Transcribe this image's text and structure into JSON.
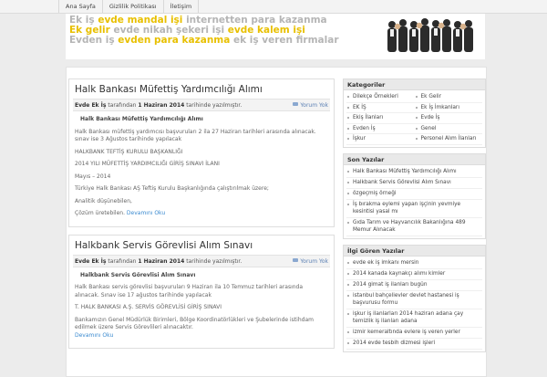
{
  "nav": [
    "Ana Sayfa",
    "Gizlilik Politikası",
    "İletişim"
  ],
  "banner": {
    "line1": [
      {
        "t": "Ek iş",
        "c": "#b5b5b5"
      },
      {
        "t": "evde mandal işi",
        "c": "#e8c000"
      },
      {
        "t": "internetten para kazanma",
        "c": "#b5b5b5"
      }
    ],
    "line2": [
      {
        "t": "Ek gelir",
        "c": "#e8c000"
      },
      {
        "t": "evde nikah şekeri işi",
        "c": "#b5b5b5"
      },
      {
        "t": "evde kalem işi",
        "c": "#e8c000"
      }
    ],
    "line3": [
      {
        "t": "Evden iş",
        "c": "#b5b5b5"
      },
      {
        "t": "evden para kazanma",
        "c": "#e8c000"
      },
      {
        "t": "ek iş veren firmalar",
        "c": "#b5b5b5"
      }
    ]
  },
  "posts": [
    {
      "title": "Halk Bankası Müfettiş Yardımcılığı Alımı",
      "author": "Evde Ek İş",
      "by_text": "tarafından",
      "date": "1 Haziran 2014",
      "date_text": "tarihinde yazılmıştır.",
      "comments": "Yorum Yok",
      "subhead": "Halk Bankası Müfettiş Yardımcılığı Alımı",
      "paragraphs": [
        "Halk Bankası müfettiş yardımcısı başvuruları 2 ila 27 Haziran tarihleri arasında alınacak. sınav ise 3 Ağustos tarihinde yapılacak",
        "HALKBANK TEFTİŞ KURULU BAŞKANLIĞI",
        "2014 YILI MÜFETTİŞ YARDIMCILIĞI GİRİŞ SINAVI İLANI",
        "Mayıs – 2014",
        "Türkiye Halk Bankası AŞ Teftiş Kurulu Başkanlığında çalıştırılmak üzere;",
        "Analitik düşünebilen,"
      ],
      "last": "Çözüm üretebilen.",
      "more": "Devamını Oku"
    },
    {
      "title": "Halkbank Servis Görevlisi Alım Sınavı",
      "author": "Evde Ek İş",
      "by_text": "tarafından",
      "date": "1 Haziran 2014",
      "date_text": "tarihinde yazılmıştır.",
      "comments": "Yorum Yok",
      "subhead": "Halkbank Servis Görevlisi Alım Sınavı",
      "paragraphs": [
        "Halk Bankası servis görevlisi başvuruları 9 Haziran ila 10 Temmuz tarihleri arasında alınacak. Sınav ise 17 ağustos tarihinde yapılacak",
        "T. HALK BANKASI A.Ş. SERVİS GÖREVLİSİ GİRİŞ SINAVI"
      ],
      "last": "Bankamızın Genel Müdürlük Birimleri, Bölge Koordinatörlükleri ve Şubelerinde istihdam edilmek üzere Servis Görevlileri alınacaktır.",
      "more": "Devamını Oku"
    }
  ],
  "sidebar": {
    "categories_title": "Kategoriler",
    "categories": [
      "Dilekçe Örnekleri",
      "Ek Gelir",
      "EK İŞ",
      "Ek İş İmkanları",
      "Ekiş İlanları",
      "Evde İş",
      "Evden İş",
      "Genel",
      "İşkur",
      "Personel Alım İlanları"
    ],
    "recent_title": "Son Yazılar",
    "recent": [
      "Halk Bankası Müfettiş Yardımcılığı Alımı",
      "Halkbank Servis Görevlisi Alım Sınavı",
      "özgeçmiş örneği",
      "İş bırakma eylemi yapan işçinin yevmiye kesintisi yasal mı",
      "Gıda Tarım ve Hayvancılık Bakanlığına 489 Memur Alınacak"
    ],
    "popular_title": "İlgi Gören Yazılar",
    "popular": [
      "evde ek iş imkanı mersin",
      "2014 kanada kaynakçı alımı kimler",
      "2014 gimat iş ilanları bugün",
      "istanbul bahçelievler devlet hastanesi iş başvurusu formu",
      "işkur iş ilanlarları 2014 haziran adana çay temizlik iş ilanları adana",
      "izmir kemeraltında evlere iş veren yerler",
      "2014 evde tesbih dizmesi işleri"
    ]
  }
}
